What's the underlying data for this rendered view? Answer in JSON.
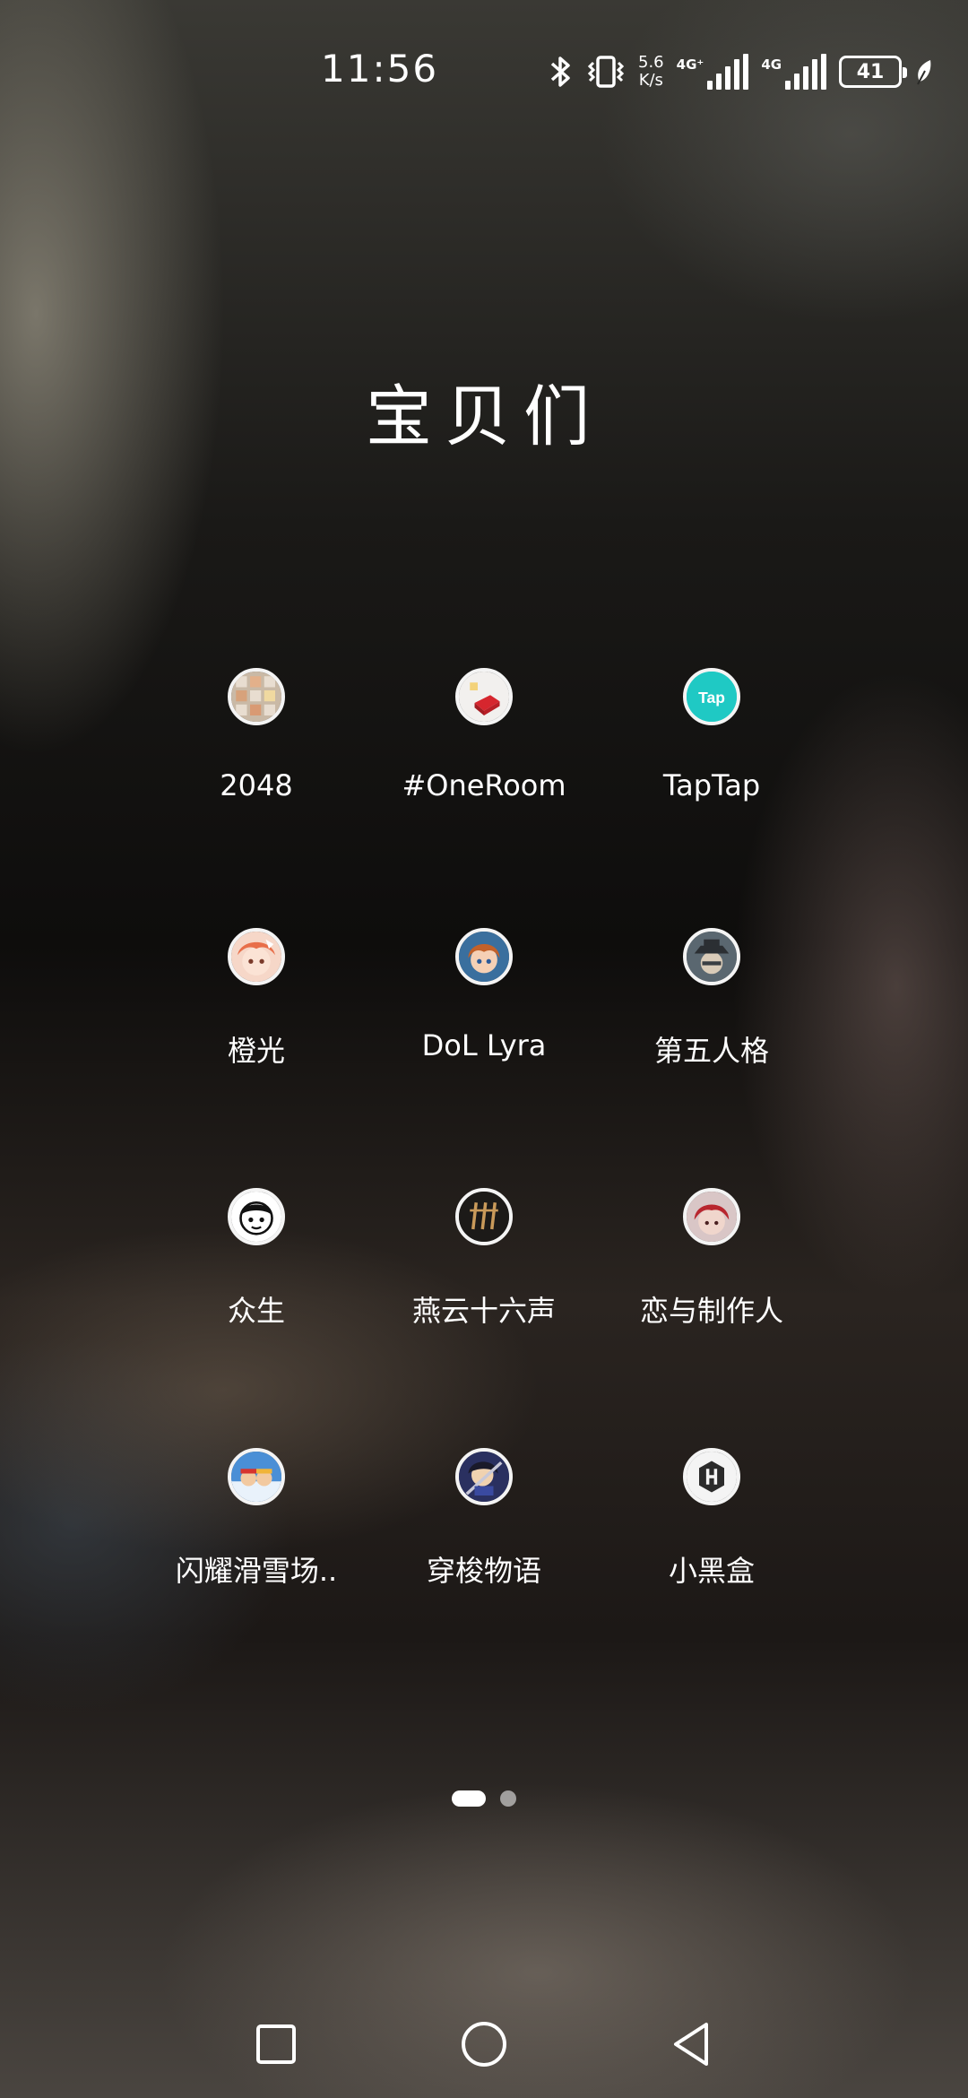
{
  "status_bar": {
    "time": "11:56",
    "speed_value": "5.6",
    "speed_unit": "K/s",
    "sim1_label": "4G⁺",
    "sim2_label": "4G",
    "battery": "41"
  },
  "folder": {
    "title": "宝贝们"
  },
  "apps": [
    {
      "label": "2048",
      "icon": "2048-icon"
    },
    {
      "label": "#OneRoom",
      "icon": "oneroom-icon"
    },
    {
      "label": "TapTap",
      "icon": "taptap-icon",
      "icon_text": "Tap"
    },
    {
      "label": "橙光",
      "icon": "chengguang-icon"
    },
    {
      "label": "DoL Lyra",
      "icon": "dol-lyra-icon"
    },
    {
      "label": "第五人格",
      "icon": "identity-v-icon"
    },
    {
      "label": "众生",
      "icon": "zhongsheng-icon"
    },
    {
      "label": "燕云十六声",
      "icon": "yanyun-icon"
    },
    {
      "label": "恋与制作人",
      "icon": "love-producer-icon"
    },
    {
      "label": "闪耀滑雪场..",
      "icon": "ski-resort-icon"
    },
    {
      "label": "穿梭物语",
      "icon": "chuansuo-icon"
    },
    {
      "label": "小黑盒",
      "icon": "xiaoheihe-icon"
    }
  ],
  "page_indicator": {
    "pages": 2,
    "active": 1
  },
  "colors": {
    "taptap": "#1fc9c4",
    "text": "#ffffff"
  }
}
